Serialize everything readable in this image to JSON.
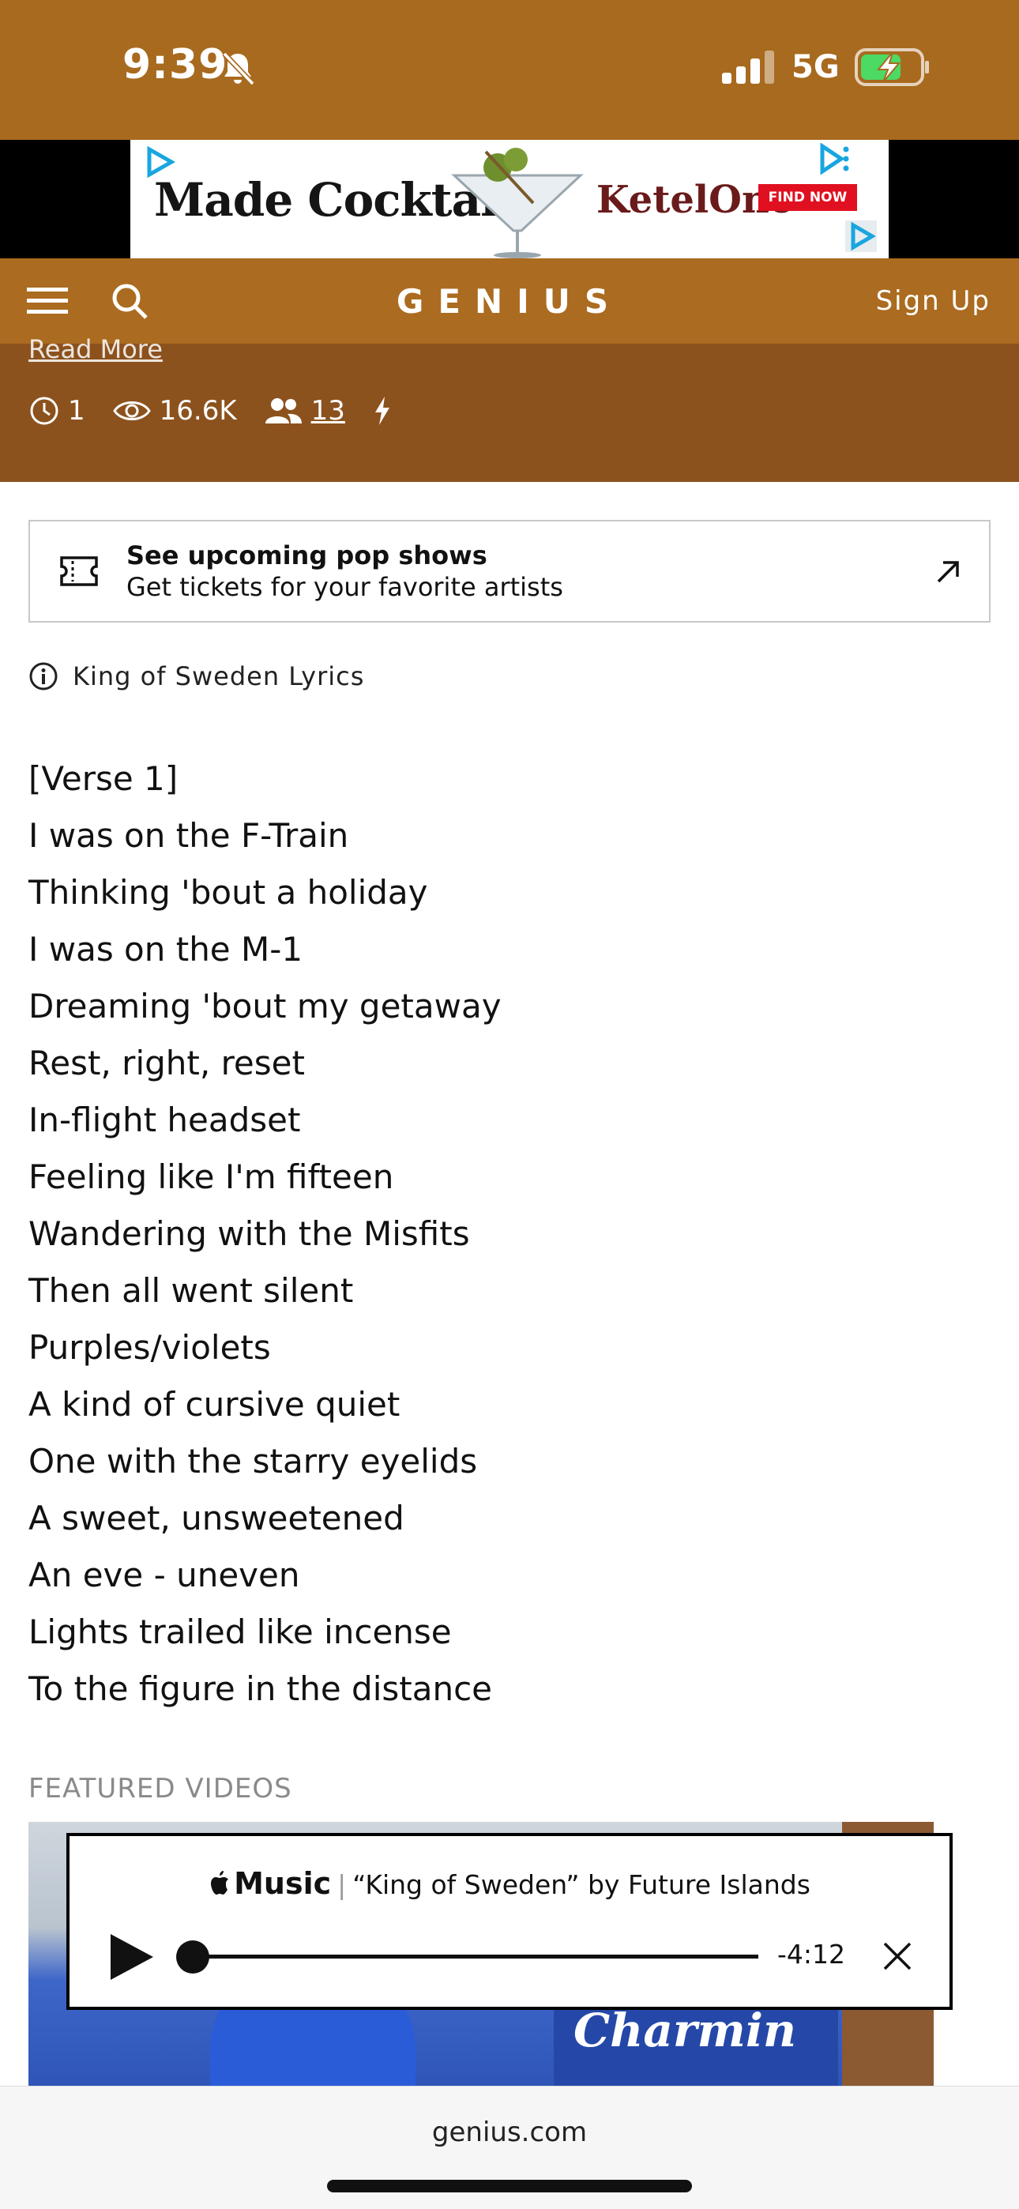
{
  "status_bar": {
    "time": "9:39",
    "network": "5G"
  },
  "ad": {
    "brand_text": "Made Cocktail",
    "vodka_text": "KetelOne",
    "cta": "FIND NOW"
  },
  "header": {
    "logo": "GENIUS",
    "signup": "Sign Up",
    "icons": [
      "menu-icon",
      "search-icon"
    ]
  },
  "song_header": {
    "read_more": "Read More",
    "stats": {
      "clock_value": "1",
      "views_value": "16.6K",
      "contributors_value": "13"
    }
  },
  "tickets": {
    "title": "See upcoming pop shows",
    "subtitle": "Get tickets for your favorite artists"
  },
  "lyrics_title": "King of Sweden Lyrics",
  "lyrics": [
    "[Verse 1]",
    "I was on the F-Train",
    "Thinking 'bout a holiday",
    "I was on the M-1",
    "Dreaming 'bout my getaway",
    "Rest, right, reset",
    "In-flight headset",
    "Feeling like I'm fifteen",
    "Wandering with the Misfits",
    "Then all went silent",
    "Purples/violets",
    "A kind of cursive quiet",
    "One with the starry eyelids",
    "A sweet, unsweetened",
    "An eve - uneven",
    "Lights trailed like incense",
    "To the figure in the distance"
  ],
  "featured_videos_label": "FEATURED VIDEOS",
  "video": {
    "package_text": "Charmin"
  },
  "player": {
    "service": "Music",
    "track": "“King of Sweden” by Future Islands",
    "time_remaining": "-4:12",
    "progress": 0
  },
  "browser": {
    "url": "genius.com"
  },
  "colors": {
    "status_bg": "#a86a1f",
    "header_bg": "#ab6b20",
    "song_header_bg": "#8c521e"
  }
}
